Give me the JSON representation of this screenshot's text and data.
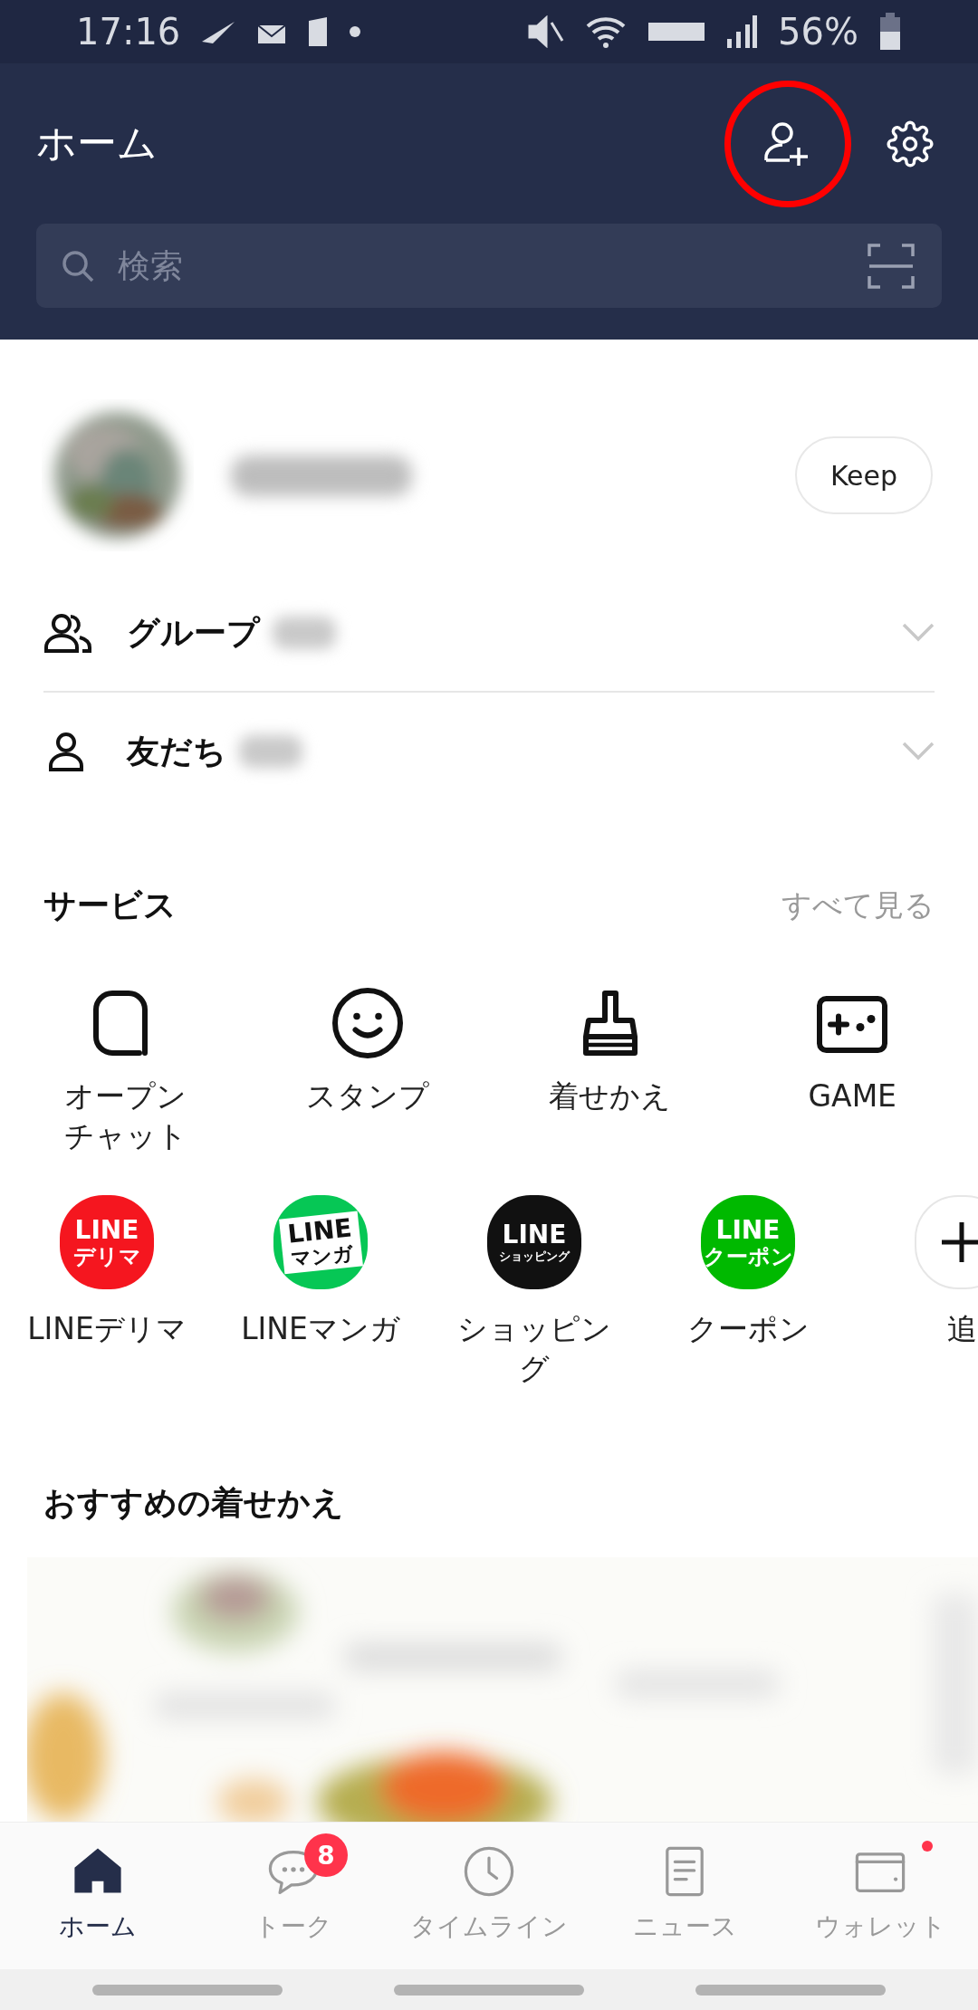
{
  "status_bar": {
    "time": "17:16",
    "battery": "56%"
  },
  "header": {
    "title": "ホーム",
    "add_friend": {
      "highlighted": true
    }
  },
  "search": {
    "placeholder": "検索"
  },
  "profile": {
    "keep_button": "Keep"
  },
  "lists": [
    {
      "kind": "group",
      "label": "グループ",
      "expanded": false
    },
    {
      "kind": "friend",
      "label": "友だち",
      "expanded": false
    }
  ],
  "services": {
    "title": "サービス",
    "see_all": "すべて見る",
    "main": [
      {
        "kind": "openchat",
        "label": "オープンチャット"
      },
      {
        "kind": "sticker",
        "label": "スタンプ"
      },
      {
        "kind": "theme",
        "label": "着せかえ"
      },
      {
        "kind": "game",
        "label": "GAME"
      }
    ],
    "apps": [
      {
        "kind": "logo",
        "logo_top": "LINE",
        "logo_bottom": "デリマ",
        "color": "#f5161f",
        "label": "LINEデリマ"
      },
      {
        "kind": "manga",
        "logo_top": "LINE",
        "logo_bottom": "マンガ",
        "color": "#06c755",
        "label": "LINEマンガ"
      },
      {
        "kind": "logo",
        "logo_top": "LINE",
        "logo_bottom": "ショッピング",
        "color": "#111111",
        "label": "ショッピング"
      },
      {
        "kind": "logo",
        "logo_top": "LINE",
        "logo_bottom": "クーポン",
        "color": "#00b900",
        "label": "クーポン"
      },
      {
        "kind": "add",
        "label": "追"
      }
    ]
  },
  "recommended": {
    "title": "おすすめの着せかえ",
    "kind": "picture"
  },
  "bottom_nav": [
    {
      "kind": "home",
      "label": "ホーム",
      "selected": true
    },
    {
      "kind": "talk",
      "label": "トーク",
      "selected": false,
      "badge": "8"
    },
    {
      "kind": "timeline",
      "label": "タイムライン",
      "selected": false
    },
    {
      "kind": "news",
      "label": "ニュース",
      "selected": false
    },
    {
      "kind": "wallet",
      "label": "ウォレット",
      "selected": false,
      "dot": true
    }
  ]
}
